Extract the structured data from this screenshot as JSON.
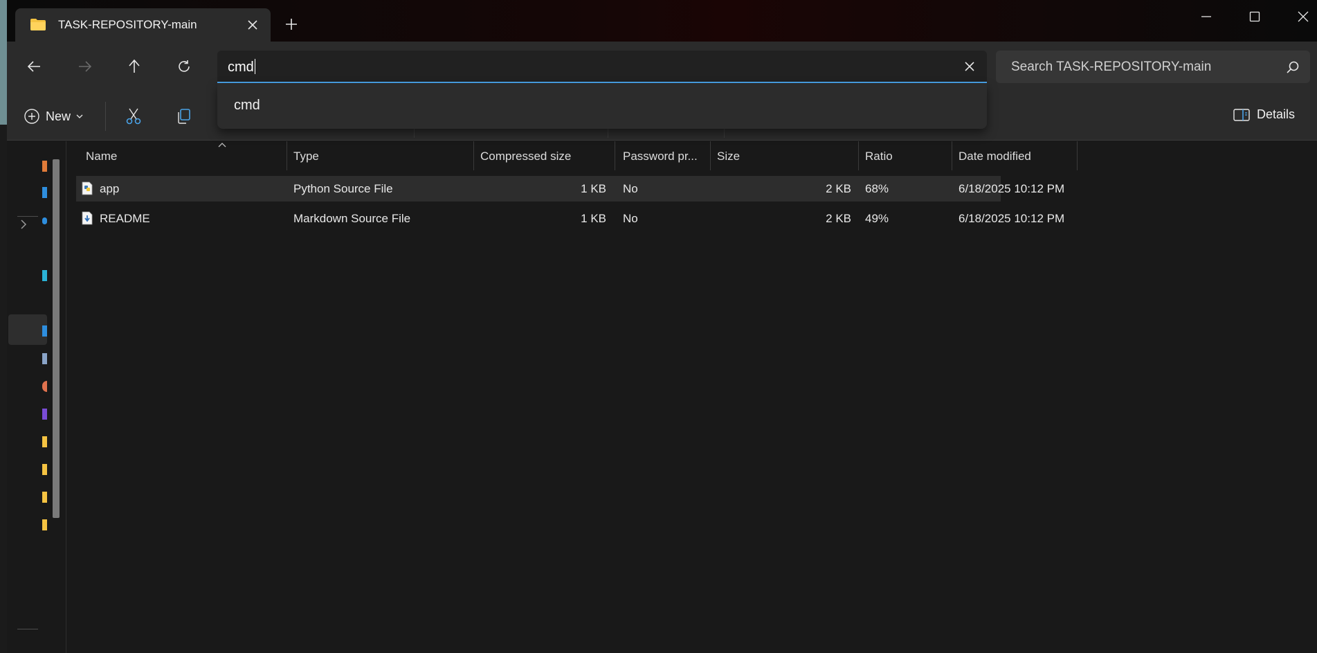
{
  "window": {
    "tab_title": "TASK-REPOSITORY-main"
  },
  "address_bar": {
    "value": "cmd"
  },
  "search": {
    "placeholder": "Search TASK-REPOSITORY-main"
  },
  "autocomplete": {
    "items": [
      "cmd"
    ]
  },
  "command_bar": {
    "new_label": "New",
    "details_label": "Details"
  },
  "columns": [
    "Name",
    "Type",
    "Compressed size",
    "Password pr...",
    "Size",
    "Ratio",
    "Date modified"
  ],
  "files": [
    {
      "name": "app",
      "type": "Python Source File",
      "compressed_size": "1 KB",
      "password_protected": "No",
      "size": "2 KB",
      "ratio": "68%",
      "date_modified": "6/18/2025 10:12 PM",
      "icon": "python-file-icon"
    },
    {
      "name": "README",
      "type": "Markdown Source File",
      "compressed_size": "1 KB",
      "password_protected": "No",
      "size": "2 KB",
      "ratio": "49%",
      "date_modified": "6/18/2025 10:12 PM",
      "icon": "markdown-file-icon"
    }
  ],
  "colors": {
    "accent": "#4aa3e8",
    "background": "#191919",
    "toolbar": "#2b2b2b"
  }
}
